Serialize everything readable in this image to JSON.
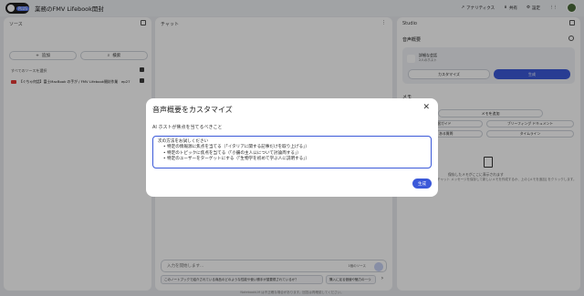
{
  "header": {
    "logo_badge": "PLUS",
    "notebook_title": "業務のFMV Lifebook開封",
    "analytics_label": "アナリティクス",
    "share_label": "共有",
    "settings_label": "設定"
  },
  "sources": {
    "title": "ソース",
    "add_label": "追加",
    "search_label": "検索",
    "select_all_label": "すべてのソースを選択",
    "items": [
      {
        "label": "【ぐちゃ何話】富士MacBook の手が / FMV Lifebook開封作業　ep27"
      }
    ]
  },
  "chat": {
    "title": "チャット",
    "input_placeholder": "入力を開始します...",
    "source_count": "1個のソース",
    "suggestions": [
      "このノートブックで紹介されている商品のどのような性能や使い勝手が重要視されているか？",
      "購入に足る価値や魅力の一つ"
    ]
  },
  "studio": {
    "title": "Studio",
    "audio_overview_title": "音声概要",
    "audio_card_title": "詳細な会話",
    "audio_card_sub": "2人のホスト",
    "customize_label": "カスタマイズ",
    "generate_label": "生成",
    "notes_title": "メモ",
    "add_note_label": "メモを追加",
    "chip_guide": "学習ガイド",
    "chip_briefing": "ブリーフィング ドキュメント",
    "chip_faq": "よくある質問",
    "chip_timeline": "タイムライン",
    "empty_text_1": "保存したメモがここに表示されます",
    "empty_text_2": "チャット メッセージを保存して新しいメモを作成するか、上の [メモを追加] をクリックします。"
  },
  "footer": {
    "text": "NotebookLM は不正確な場合があります。回答は再確認してください。"
  },
  "modal": {
    "title": "音声概要をカスタマイズ",
    "close_glyph": "✕",
    "prompt_label": "AI ホストが焦点を当てるべきこと",
    "textarea_value": "次の方法をお試しください\n    • 特定の情報源に焦点を当てる（「イタリアに関する記事だけを取り上げる」）\n    • 特定のトピックに焦点を当てる（「小腸の主人公について討論両する」）\n    • 特定のユーザーをターゲットにする（「生物学を初めて学ぶ人に説明する」）",
    "generate_label": "生成"
  },
  "colors": {
    "accent": "#3b59d9",
    "overlay": "rgba(0,0,0,0.32)"
  }
}
